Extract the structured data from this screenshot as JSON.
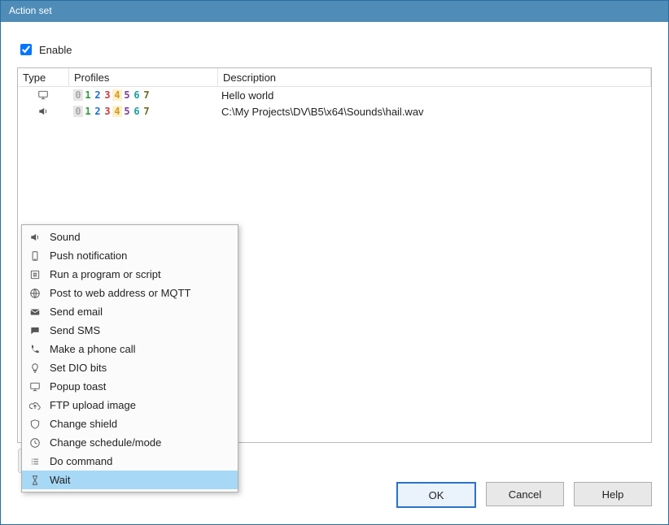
{
  "window": {
    "title": "Action set"
  },
  "enable": {
    "label": "Enable",
    "checked": true
  },
  "columns": {
    "type": "Type",
    "profiles": "Profiles",
    "description": "Description"
  },
  "profileDigits": [
    "0",
    "1",
    "2",
    "3",
    "4",
    "5",
    "6",
    "7"
  ],
  "rows": [
    {
      "icon": "monitor",
      "description": "Hello world"
    },
    {
      "icon": "speaker",
      "description": "C:\\My Projects\\DV\\B5\\x64\\Sounds\\hail.wav"
    }
  ],
  "menu": {
    "items": [
      {
        "icon": "speaker",
        "label": "Sound"
      },
      {
        "icon": "phone-box",
        "label": "Push notification"
      },
      {
        "icon": "list-box",
        "label": "Run a program or script"
      },
      {
        "icon": "globe",
        "label": "Post to web address or MQTT"
      },
      {
        "icon": "mail",
        "label": "Send email"
      },
      {
        "icon": "chat",
        "label": "Send SMS"
      },
      {
        "icon": "phonecall",
        "label": "Make a phone call"
      },
      {
        "icon": "bulb",
        "label": "Set DIO bits"
      },
      {
        "icon": "monitor",
        "label": "Popup toast"
      },
      {
        "icon": "cloud-up",
        "label": "FTP upload image"
      },
      {
        "icon": "shield",
        "label": "Change shield"
      },
      {
        "icon": "clock",
        "label": "Change schedule/mode"
      },
      {
        "icon": "lines",
        "label": "Do command"
      },
      {
        "icon": "hourglass",
        "label": "Wait"
      }
    ],
    "selectedIndex": 13
  },
  "toolbar": [
    {
      "name": "add",
      "icon": "plus"
    },
    {
      "name": "delete",
      "icon": "trash"
    },
    {
      "name": "duplicate",
      "icon": "copy"
    },
    {
      "name": "edit",
      "icon": "pencil"
    },
    {
      "name": "move-up",
      "icon": "arrow-up"
    },
    {
      "name": "move-down",
      "icon": "arrow-down"
    },
    {
      "name": "run",
      "icon": "play"
    }
  ],
  "buttons": {
    "ok": "OK",
    "cancel": "Cancel",
    "help": "Help"
  }
}
